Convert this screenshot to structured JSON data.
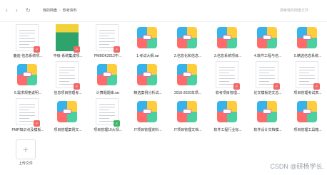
{
  "topbar": {
    "back_icon": "chevron-left-icon",
    "forward_icon": "chevron-right-icon",
    "refresh_icon": "refresh-icon",
    "breadcrumb": [
      "我的网盘",
      "软考资料"
    ],
    "search_placeholder": "搜索我的网盘文件"
  },
  "files": [
    {
      "name": "鹿迪-信息系统项...",
      "kind": "doc"
    },
    {
      "name": "中级-系统集成项...",
      "kind": "cover-green"
    },
    {
      "name": "PMBOK2012中...",
      "kind": "doc"
    },
    {
      "name": "1.考试大纲.rar",
      "kind": "zip"
    },
    {
      "name": "2.信息化和信息...",
      "kind": "zip"
    },
    {
      "name": "3.信息系统项目...",
      "kind": "zip"
    },
    {
      "name": "4.软件工程与信...",
      "kind": "zip"
    },
    {
      "name": "5.精选信息系统...",
      "kind": "zip"
    },
    {
      "name": "6.需求规格说明...",
      "kind": "zip"
    },
    {
      "name": "信息项目管理考...",
      "kind": "doc"
    },
    {
      "name": "计算题题库.rar",
      "kind": "zip"
    },
    {
      "name": "精选案例分析试...",
      "kind": "zip"
    },
    {
      "name": "2018-2020年项...",
      "kind": "zip"
    },
    {
      "name": "软考项目管理...",
      "kind": "doc"
    },
    {
      "name": "论文模板范文总...",
      "kind": "doc"
    },
    {
      "name": "项目管理考试真...",
      "kind": "doc"
    },
    {
      "name": "PMP知识点及模板...",
      "kind": "doc"
    },
    {
      "name": "项目管理案例文...",
      "kind": "zip"
    },
    {
      "name": "项目管理10大领...",
      "kind": "xls"
    },
    {
      "name": "IT项目管理资料...",
      "kind": "zip"
    },
    {
      "name": "IT项目管理文档...",
      "kind": "zip"
    },
    {
      "name": "软件工程行业标...",
      "kind": "zip"
    },
    {
      "name": "软件设计文档模...",
      "kind": "zip"
    },
    {
      "name": "项目管理工具箱...",
      "kind": "zip"
    }
  ],
  "upload": {
    "label": "上传文件"
  },
  "watermark": "CSDN @研杨学长."
}
